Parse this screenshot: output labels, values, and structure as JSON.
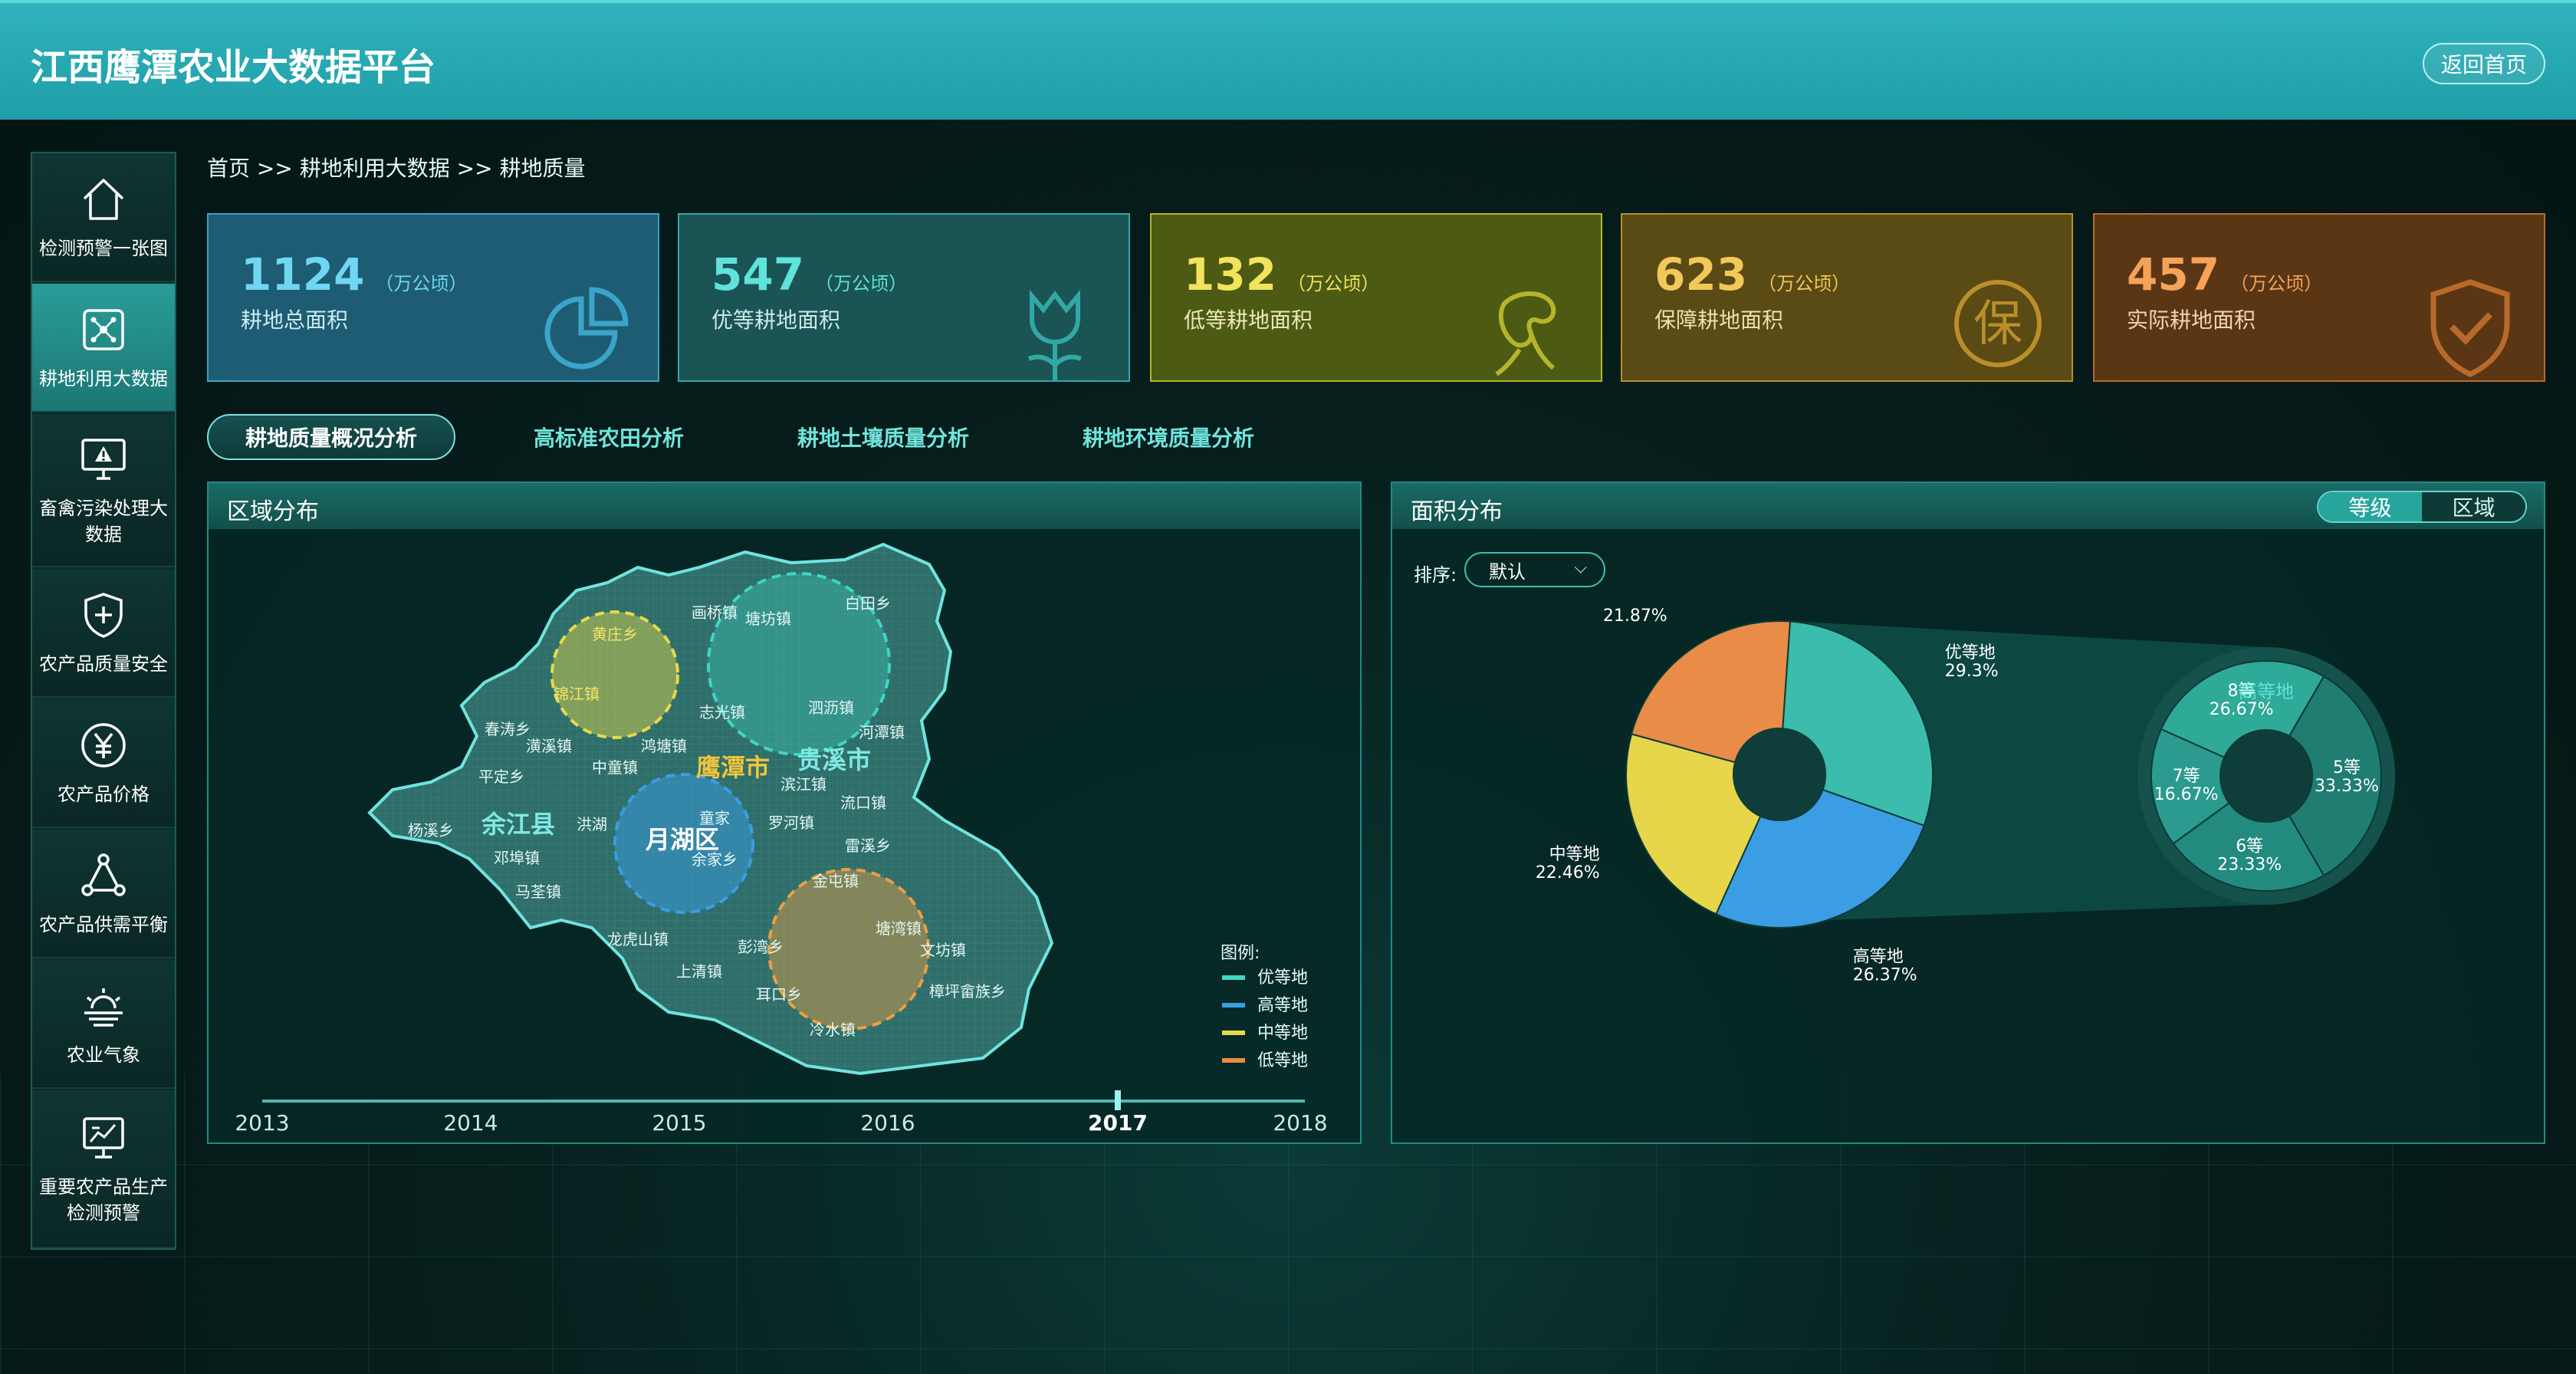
{
  "header": {
    "title": "江西鹰潭农业大数据平台",
    "home_button": "返回首页"
  },
  "sidebar": {
    "items": [
      {
        "label": "检测预警一张图",
        "icon": "home-icon"
      },
      {
        "label": "耕地利用大数据",
        "icon": "network-icon",
        "active": true
      },
      {
        "label": "畜禽污染处理大数据",
        "icon": "monitor-alert-icon"
      },
      {
        "label": "农产品质量安全",
        "icon": "shield-plus-icon"
      },
      {
        "label": "农产品价格",
        "icon": "yuan-icon"
      },
      {
        "label": "农产品供需平衡",
        "icon": "triangle-nodes-icon"
      },
      {
        "label": "农业气象",
        "icon": "weather-icon"
      },
      {
        "label": "重要农产品生产检测预警",
        "icon": "chart-board-icon"
      }
    ]
  },
  "breadcrumb": "首页 >> 耕地利用大数据 >> 耕地质量",
  "cards": [
    {
      "value": "1124",
      "unit": "（万公顷）",
      "label": "耕地总面积",
      "icon": "pie-icon"
    },
    {
      "value": "547",
      "unit": "（万公顷）",
      "label": "优等耕地面积",
      "icon": "tulip-icon"
    },
    {
      "value": "132",
      "unit": "（万公顷）",
      "label": "低等耕地面积",
      "icon": "wilted-plant-icon"
    },
    {
      "value": "623",
      "unit": "（万公顷）",
      "label": "保障耕地面积",
      "icon": "guarantee-seal-icon"
    },
    {
      "value": "457",
      "unit": "（万公顷）",
      "label": "实际耕地面积",
      "icon": "shield-check-icon"
    }
  ],
  "tabs": [
    "耕地质量概况分析",
    "高标准农田分析",
    "耕地土壤质量分析",
    "耕地环境质量分析"
  ],
  "left_panel": {
    "title": "区域分布",
    "map_labels": {
      "cities": [
        "鹰潭市",
        "贵溪市",
        "余江县",
        "月湖区"
      ],
      "towns": [
        "白田乡",
        "画桥镇",
        "塘坊镇",
        "黄庄乡",
        "锦江镇",
        "志光镇",
        "泗沥镇",
        "河潭镇",
        "春涛乡",
        "潢溪镇",
        "鸿塘镇",
        "中童镇",
        "平定乡",
        "滨江镇",
        "流口镇",
        "杨溪乡",
        "洪湖",
        "童家",
        "罗河镇",
        "雷溪乡",
        "邓埠镇",
        "余家乡",
        "金屯镇",
        "马荃镇",
        "龙虎山镇",
        "彭湾乡",
        "塘湾镇",
        "文坊镇",
        "上清镇",
        "耳口乡",
        "樟坪畲族乡",
        "冷水镇"
      ]
    },
    "legend_title": "图例:",
    "legend": [
      {
        "name": "优等地",
        "color": "#3fd6c4"
      },
      {
        "name": "高等地",
        "color": "#3a9ee6"
      },
      {
        "name": "中等地",
        "color": "#e8d94a"
      },
      {
        "name": "低等地",
        "color": "#e98c45"
      }
    ],
    "timeline": {
      "years": [
        "2013",
        "2014",
        "2015",
        "2016",
        "2017",
        "2018"
      ],
      "selected": "2017"
    }
  },
  "right_panel": {
    "title": "面积分布",
    "toggle": {
      "options": [
        "等级",
        "区域"
      ],
      "selected": "等级"
    },
    "sort_label": "排序:",
    "sort_value": "默认",
    "drilldown_title": "高等地"
  },
  "chart_data": [
    {
      "type": "pie",
      "title": "",
      "categories": [
        "优等地",
        "高等地",
        "中等地",
        "低等地"
      ],
      "values": [
        29.3,
        26.37,
        22.46,
        21.87
      ],
      "labels": [
        "29.3%",
        "26.37%",
        "22.46%",
        "21.87%"
      ],
      "colors": [
        "#3cbcac",
        "#3b9de3",
        "#e7d54a",
        "#e88c48"
      ]
    },
    {
      "type": "pie",
      "title": "高等地",
      "categories": [
        "5等",
        "6等",
        "7等",
        "8等"
      ],
      "values": [
        33.33,
        23.33,
        16.67,
        26.67
      ],
      "labels": [
        "33.33%",
        "23.33%",
        "16.67%",
        "26.67%"
      ],
      "colors": [
        "#1f7d72",
        "#238a7f",
        "#2a9b8e",
        "#2fa998"
      ]
    }
  ]
}
